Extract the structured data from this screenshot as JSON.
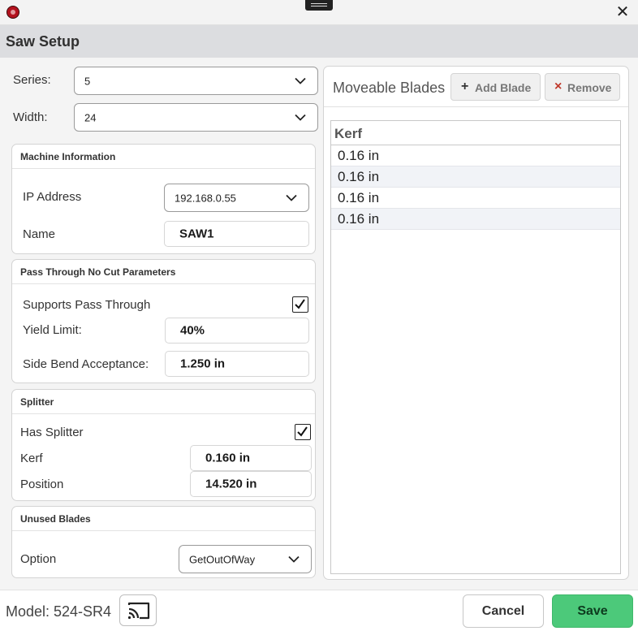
{
  "window": {
    "close_glyph": "✕"
  },
  "header": {
    "title": "Saw Setup"
  },
  "series": {
    "label": "Series:",
    "value": "5"
  },
  "width": {
    "label": "Width:",
    "value": "24"
  },
  "machine_information": {
    "title": "Machine Information",
    "ip_label": "IP Address",
    "ip_value": "192.168.0.55",
    "name_label": "Name",
    "name_value": "SAW1"
  },
  "pass_through": {
    "title": "Pass Through No Cut Parameters",
    "supports_label": "Supports Pass Through",
    "supports_checked": true,
    "yield_label": "Yield Limit:",
    "yield_value": "40%",
    "side_bend_label": "Side Bend Acceptance:",
    "side_bend_value": "1.250 in"
  },
  "splitter": {
    "title": "Splitter",
    "has_label": "Has Splitter",
    "has_checked": true,
    "kerf_label": "Kerf",
    "kerf_value": "0.160 in",
    "position_label": "Position",
    "position_value": "14.520 in"
  },
  "unused_blades": {
    "title": "Unused Blades",
    "option_label": "Option",
    "option_value": "GetOutOfWay"
  },
  "moveable_blades": {
    "title": "Moveable Blades",
    "add_icon": "+",
    "add_label": "Add Blade",
    "remove_icon": "×",
    "remove_label": "Remove",
    "column_header": "Kerf",
    "rows": [
      "0.16 in",
      "0.16 in",
      "0.16 in",
      "0.16 in"
    ]
  },
  "footer": {
    "model": "Model: 524-SR4",
    "cancel_label": "Cancel",
    "save_label": "Save"
  },
  "colors": {
    "header_bg": "#dcdde0",
    "save_green": "#4cc97a",
    "alt_row": "#f1f3f7",
    "app_icon_red": "#b3121e"
  }
}
